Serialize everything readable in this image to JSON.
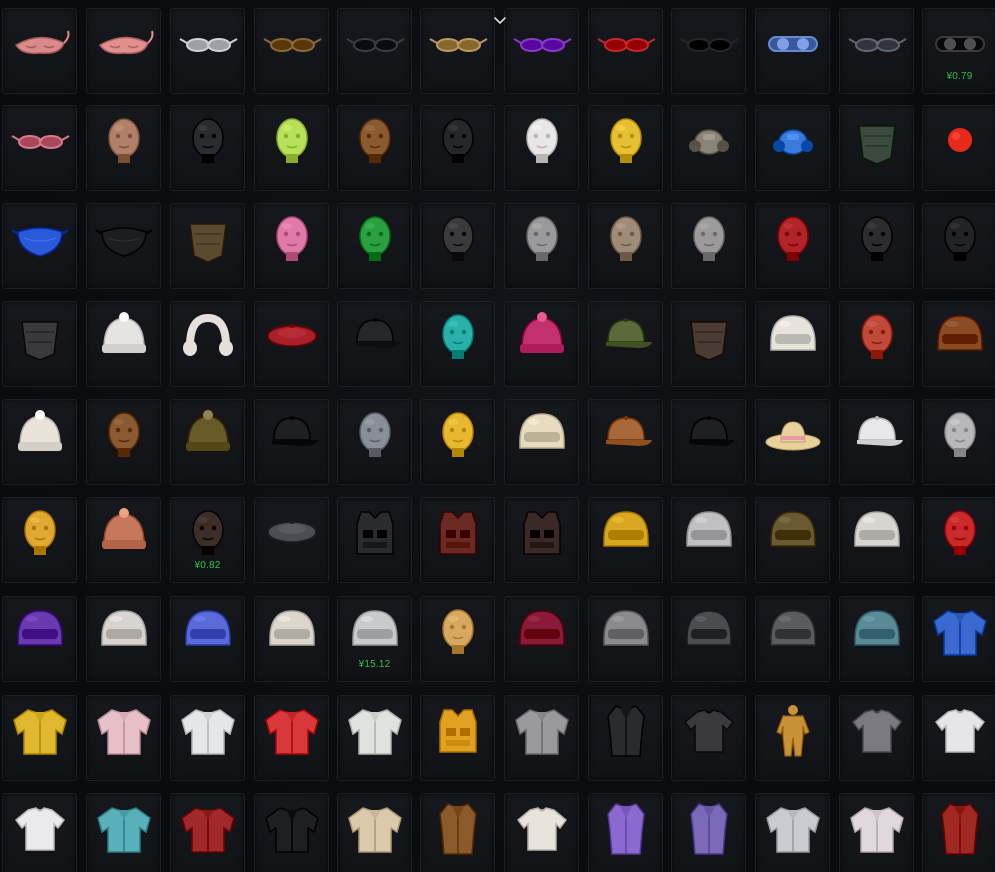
{
  "prices": {
    "row0_col11": "¥0.79",
    "row5_col2": "¥0.82",
    "row6_col4": "¥15.12"
  },
  "rows": [
    {
      "category": "eyewear",
      "items": [
        {
          "icon": "pink-sleep-mask-icon",
          "shape": "mask",
          "color": "#d98a8a"
        },
        {
          "icon": "pink-sleep-mask-icon",
          "shape": "mask",
          "color": "#e0908e"
        },
        {
          "icon": "white-sport-sunglasses-icon",
          "shape": "glasses",
          "color": "#cfd2d6"
        },
        {
          "icon": "brown-aviator-sunglasses-icon",
          "shape": "glasses",
          "color": "#8a6a3a"
        },
        {
          "icon": "black-sunglasses-icon",
          "shape": "glasses",
          "color": "#3a3d44"
        },
        {
          "icon": "gold-sunglasses-icon",
          "shape": "glasses",
          "color": "#b89a60"
        },
        {
          "icon": "purple-round-glasses-icon",
          "shape": "glasses",
          "color": "#8a3ad0"
        },
        {
          "icon": "red-cat-eye-glasses-icon",
          "shape": "glasses",
          "color": "#c8262a"
        },
        {
          "icon": "dark-sunglasses-icon",
          "shape": "glasses",
          "color": "#25272c"
        },
        {
          "icon": "steampunk-goggles-icon",
          "shape": "goggles",
          "color": "#6a8ad0"
        },
        {
          "icon": "silver-visor-sunglasses-icon",
          "shape": "glasses",
          "color": "#62666e"
        },
        {
          "icon": "black-goggles-icon",
          "shape": "goggles",
          "color": "#3a3a3e",
          "price_key": "row0_col11"
        }
      ]
    },
    {
      "category": "face-masks",
      "items": [
        {
          "icon": "pink-reading-glasses-icon",
          "shape": "glasses",
          "color": "#d87a8a"
        },
        {
          "icon": "human-head-mask-icon",
          "shape": "head",
          "color": "#b08068"
        },
        {
          "icon": "skull-mask-icon",
          "shape": "head",
          "color": "#2a2b2e"
        },
        {
          "icon": "lime-balaclava-icon",
          "shape": "head",
          "color": "#b8e05a"
        },
        {
          "icon": "chimp-mask-icon",
          "shape": "head",
          "color": "#8a5a30"
        },
        {
          "icon": "black-hood-with-glasses-icon",
          "shape": "head",
          "color": "#26272b"
        },
        {
          "icon": "bunny-gas-mask-icon",
          "shape": "head",
          "color": "#e8e6e6"
        },
        {
          "icon": "yellow-smiley-mask-icon",
          "shape": "head",
          "color": "#e6c032"
        },
        {
          "icon": "respirator-icon",
          "shape": "respirator",
          "color": "#8a8478"
        },
        {
          "icon": "ventilation-mask-icon",
          "shape": "respirator",
          "color": "#3a7ad8"
        },
        {
          "icon": "green-bandana-mask-icon",
          "shape": "bandana",
          "color": "#3a4a3c"
        },
        {
          "icon": "clown-red-nose-icon",
          "shape": "ball",
          "color": "#e82a1a"
        }
      ]
    },
    {
      "category": "masks-and-heads",
      "items": [
        {
          "icon": "blue-dragon-face-mask-icon",
          "shape": "facemask",
          "color": "#2a5ad8"
        },
        {
          "icon": "black-face-mask-icon",
          "shape": "facemask",
          "color": "#1c1d20"
        },
        {
          "icon": "camo-scarf-icon",
          "shape": "bandana",
          "color": "#5a4a32"
        },
        {
          "icon": "pink-dino-head-icon",
          "shape": "head",
          "color": "#e07aa8"
        },
        {
          "icon": "green-dino-head-icon",
          "shape": "head",
          "color": "#2aa042"
        },
        {
          "icon": "tactical-skull-helmet-icon",
          "shape": "head",
          "color": "#3a3a3c"
        },
        {
          "icon": "bald-head-icon",
          "shape": "head",
          "color": "#9a9a9c"
        },
        {
          "icon": "bearded-head-icon",
          "shape": "head",
          "color": "#a08a78"
        },
        {
          "icon": "bald-head-icon",
          "shape": "head",
          "color": "#9c9a9a"
        },
        {
          "icon": "red-luchador-mask-icon",
          "shape": "head",
          "color": "#b0242a"
        },
        {
          "icon": "spiked-leather-mask-icon",
          "shape": "head",
          "color": "#2c2c2e"
        },
        {
          "icon": "black-gas-mask-icon",
          "shape": "head",
          "color": "#222326"
        }
      ]
    },
    {
      "category": "hats",
      "items": [
        {
          "icon": "lace-veil-icon",
          "shape": "bandana",
          "color": "#3a3a3e"
        },
        {
          "icon": "white-bear-beanie-icon",
          "shape": "beanie",
          "color": "#e6e4e2"
        },
        {
          "icon": "white-fur-earmuffs-icon",
          "shape": "earmuff",
          "color": "#e4dfd8"
        },
        {
          "icon": "red-beret-icon",
          "shape": "beret",
          "color": "#a8202a"
        },
        {
          "icon": "black-cap-with-headphones-icon",
          "shape": "cap",
          "color": "#26272b"
        },
        {
          "icon": "owl-hat-icon",
          "shape": "head",
          "color": "#2ab0a8"
        },
        {
          "icon": "pink-beanie-icon",
          "shape": "beanie",
          "color": "#c2306e"
        },
        {
          "icon": "army-cap-with-headset-icon",
          "shape": "cap",
          "color": "#5a6a3a"
        },
        {
          "icon": "ragged-cloth-icon",
          "shape": "bandana",
          "color": "#4a3c32"
        },
        {
          "icon": "astronaut-helmet-icon",
          "shape": "helmet",
          "color": "#e6e2dc"
        },
        {
          "icon": "sausage-mask-icon",
          "shape": "head",
          "color": "#c04a3a"
        },
        {
          "icon": "brass-diving-helmet-icon",
          "shape": "helmet",
          "color": "#8a4a22"
        }
      ]
    },
    {
      "category": "hats-and-heads",
      "items": [
        {
          "icon": "white-frilly-bonnet-icon",
          "shape": "beanie",
          "color": "#e8e2d8"
        },
        {
          "icon": "brown-bear-head-icon",
          "shape": "head",
          "color": "#8a5a32"
        },
        {
          "icon": "rasta-beanie-icon",
          "shape": "beanie",
          "color": "#6a5a2a"
        },
        {
          "icon": "red-black-cap-icon",
          "shape": "cap",
          "color": "#1e1f22"
        },
        {
          "icon": "shark-head-icon",
          "shape": "head",
          "color": "#8a8e96"
        },
        {
          "icon": "chicken-head-icon",
          "shape": "head",
          "color": "#e8b830"
        },
        {
          "icon": "pith-helmet-icon",
          "shape": "helmet",
          "color": "#e8dcc0"
        },
        {
          "icon": "aviator-cap-icon",
          "shape": "cap",
          "color": "#a8683a"
        },
        {
          "icon": "black-baseball-cap-icon",
          "shape": "cap",
          "color": "#1e1f22"
        },
        {
          "icon": "straw-sun-hat-icon",
          "shape": "sunhat",
          "color": "#e8d29a"
        },
        {
          "icon": "captain-hat-icon",
          "shape": "cap",
          "color": "#e8e8ea"
        },
        {
          "icon": "teddy-bear-head-icon",
          "shape": "head",
          "color": "#b8b8bc"
        }
      ]
    },
    {
      "category": "helmets-and-vests",
      "items": [
        {
          "icon": "yellow-dino-head-icon",
          "shape": "head",
          "color": "#e0a830"
        },
        {
          "icon": "knit-pompom-hat-icon",
          "shape": "beanie",
          "color": "#c8785a"
        },
        {
          "icon": "dreadlock-hood-icon",
          "shape": "head",
          "color": "#3a2e26",
          "price_key": "row5_col2"
        },
        {
          "icon": "grey-beret-icon",
          "shape": "beret",
          "color": "#4a4d54"
        },
        {
          "icon": "black-tactical-vest-icon",
          "shape": "vest",
          "color": "#2a2b2e"
        },
        {
          "icon": "red-plate-carrier-icon",
          "shape": "vest",
          "color": "#6a2a22"
        },
        {
          "icon": "dark-camo-vest-icon",
          "shape": "vest",
          "color": "#3a2a26"
        },
        {
          "icon": "yellow-green-motor-helmet-icon",
          "shape": "helmet",
          "color": "#d8a820"
        },
        {
          "icon": "viking-helmet-icon",
          "shape": "helmet",
          "color": "#c0c0c4"
        },
        {
          "icon": "camo-combat-helmet-icon",
          "shape": "helmet",
          "color": "#6a5a32"
        },
        {
          "icon": "white-combat-helmet-icon",
          "shape": "helmet",
          "color": "#d8d6d0"
        },
        {
          "icon": "santa-hat-head-icon",
          "shape": "head",
          "color": "#c82a2a"
        }
      ]
    },
    {
      "category": "helmets",
      "items": [
        {
          "icon": "cat-ear-motor-helmet-icon",
          "shape": "helmet",
          "color": "#6a3ab0"
        },
        {
          "icon": "floral-combat-helmet-icon",
          "shape": "helmet",
          "color": "#d8d4d0"
        },
        {
          "icon": "galaxy-level3-helmet-icon",
          "shape": "helmet",
          "color": "#5a6ad8"
        },
        {
          "icon": "cow-print-helmet-icon",
          "shape": "helmet",
          "color": "#dcd6cc"
        },
        {
          "icon": "silver-level3-helmet-icon",
          "shape": "helmet",
          "color": "#c8cacc",
          "price_key": "row6_col4"
        },
        {
          "icon": "shiba-dog-helmet-icon",
          "shape": "head",
          "color": "#d8a860"
        },
        {
          "icon": "red-black-motor-helmet-icon",
          "shape": "helmet",
          "color": "#8a1a3a"
        },
        {
          "icon": "mouse-ear-helmet-icon",
          "shape": "helmet",
          "color": "#8a8a8e"
        },
        {
          "icon": "level3-spetsnaz-helmet-icon",
          "shape": "helmet",
          "color": "#4a4c50"
        },
        {
          "icon": "level2-military-helmet-icon",
          "shape": "helmet",
          "color": "#5a5c60"
        },
        {
          "icon": "teal-camo-helmet-icon",
          "shape": "helmet",
          "color": "#5a8a96"
        },
        {
          "icon": "blue-hoodie-icon",
          "shape": "jacket",
          "color": "#3a6ad0"
        }
      ]
    },
    {
      "category": "jackets",
      "items": [
        {
          "icon": "yellow-camo-jacket-icon",
          "shape": "jacket",
          "color": "#e0b830"
        },
        {
          "icon": "pink-puffer-jacket-icon",
          "shape": "jacket",
          "color": "#e8c0c8"
        },
        {
          "icon": "white-trench-coat-icon",
          "shape": "jacket",
          "color": "#e4e6ea"
        },
        {
          "icon": "red-white-track-jacket-icon",
          "shape": "jacket",
          "color": "#d8383a"
        },
        {
          "icon": "white-hoodie-green-icon",
          "shape": "jacket",
          "color": "#e0e2e0"
        },
        {
          "icon": "orange-puffer-vest-icon",
          "shape": "vest",
          "color": "#e0a020"
        },
        {
          "icon": "grey-red-bomber-icon",
          "shape": "jacket",
          "color": "#9a9a9e"
        },
        {
          "icon": "black-long-coat-icon",
          "shape": "coat",
          "color": "#2a2b2e"
        },
        {
          "icon": "black-crop-top-icon",
          "shape": "shirt",
          "color": "#3a3a3e"
        },
        {
          "icon": "tan-jumpsuit-icon",
          "shape": "jumpsuit",
          "color": "#c8923a"
        },
        {
          "icon": "grey-button-shirt-icon",
          "shape": "shirt",
          "color": "#7a7a80"
        },
        {
          "icon": "white-t-shirt-icon",
          "shape": "shirt",
          "color": "#e6e6e8"
        }
      ]
    },
    {
      "category": "shirts-and-coats",
      "items": [
        {
          "icon": "white-t-shirt-icon",
          "shape": "shirt",
          "color": "#eaeaec"
        },
        {
          "icon": "teal-floral-shirt-icon",
          "shape": "jacket",
          "color": "#5ab0b8"
        },
        {
          "icon": "red-black-jacket-icon",
          "shape": "jacket",
          "color": "#a02a2a"
        },
        {
          "icon": "black-suit-jacket-icon",
          "shape": "jacket",
          "color": "#1e1f22"
        },
        {
          "icon": "beige-crop-jacket-icon",
          "shape": "jacket",
          "color": "#dcc8aa"
        },
        {
          "icon": "leopard-fur-coat-icon",
          "shape": "coat",
          "color": "#8a5a2a"
        },
        {
          "icon": "white-fur-shrug-icon",
          "shape": "shirt",
          "color": "#e8e4dc"
        },
        {
          "icon": "pastel-long-vest-icon",
          "shape": "coat",
          "color": "#8a6ad0"
        },
        {
          "icon": "purple-two-tone-coat-icon",
          "shape": "coat",
          "color": "#7a6ab8"
        },
        {
          "icon": "grey-white-jacket-icon",
          "shape": "jacket",
          "color": "#c8ccd0"
        },
        {
          "icon": "floral-skull-shirt-icon",
          "shape": "jacket",
          "color": "#e0d8dc"
        },
        {
          "icon": "red-long-coat-icon",
          "shape": "coat",
          "color": "#a02a22"
        }
      ]
    }
  ]
}
